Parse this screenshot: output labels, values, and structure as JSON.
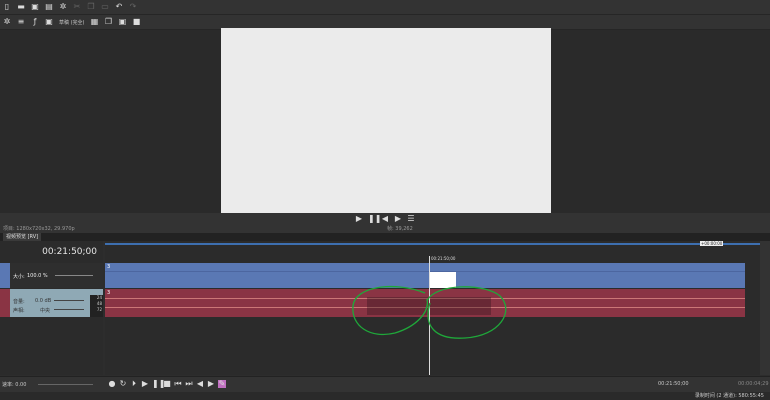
{
  "toolbar1": {
    "icons": [
      "new-icon",
      "open-icon",
      "save-icon",
      "save-as-icon",
      "settings-icon",
      "cut-icon",
      "copy-icon",
      "paste-icon",
      "undo-icon",
      "redo-icon"
    ]
  },
  "toolbar2": {
    "preview_quality": "草稿 (完全)"
  },
  "preview": {
    "project_info": "项目: 1280x720x32, 29.970p",
    "frame_info": "帧: 39,262"
  },
  "tab": {
    "label": "视频预览 [RV]"
  },
  "timeline": {
    "current_time": "00:21:50;00",
    "cursor_label": "00:21:50;00",
    "loop_label": "+00:00:00"
  },
  "video_track": {
    "size_label": "大小:",
    "size_value": "100.0 %",
    "event_label": "3"
  },
  "audio_track": {
    "volume_label": "音量:",
    "volume_value": "0.0 dB",
    "pan_label": "声相:",
    "pan_value": "中央",
    "event_label": "3",
    "meter": [
      "24",
      "48",
      "72"
    ]
  },
  "bottom": {
    "rate_label": "速率: 0.00",
    "cursor_time": "00:21:50;00",
    "selection_length": "00:00:04;29"
  },
  "status": {
    "record_time": "录制时间 (2 通道): 580:55:45"
  },
  "colors": {
    "video": "#5a78b4",
    "audio": "#8a3444",
    "annotation": "#1fa83a"
  }
}
